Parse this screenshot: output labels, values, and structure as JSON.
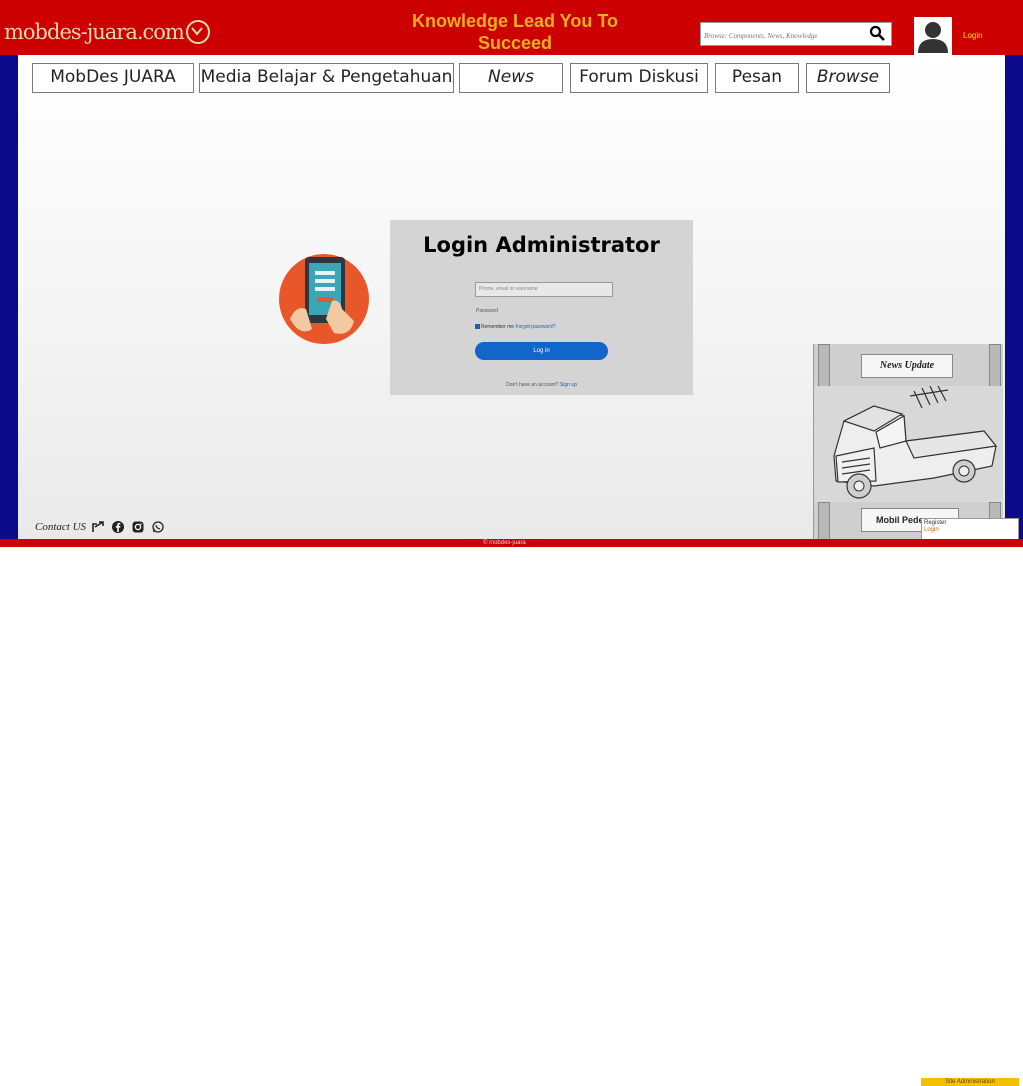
{
  "header": {
    "brand": "mobdes-juara.com",
    "tagline": "Knowledge Lead You To Succeed",
    "search_placeholder": "Browse: Components, News, Knowledge",
    "login_label": "Login"
  },
  "nav": [
    {
      "label": "MobDes JUARA"
    },
    {
      "label": "Media Belajar & Pengetahuan"
    },
    {
      "label": "News"
    },
    {
      "label": "Forum Diskusi"
    },
    {
      "label": "Pesan"
    },
    {
      "label": "Browse"
    }
  ],
  "login": {
    "title": "Login Administrator",
    "email_placeholder": "Phone, email or username",
    "password_label": "Password",
    "remember_label": "Remember me",
    "forgot_label": "Forgot password?",
    "button_label": "Log in",
    "signup_text": "Don't have an account?",
    "signup_link": "Sign up"
  },
  "news_widget": {
    "title": "News Update",
    "caption": "Mobil Pedesaan"
  },
  "dropdown": {
    "items": [
      "Register",
      "Login"
    ]
  },
  "footer": {
    "contact_label": "Contact US",
    "copyright": "© mobdes-juara",
    "admin_tab": "Site Administration"
  },
  "colors": {
    "header_red": "#cc0000",
    "frame_blue": "#0a0a8a",
    "tagline_gold": "#e8b020",
    "button_blue": "#1266c9"
  }
}
